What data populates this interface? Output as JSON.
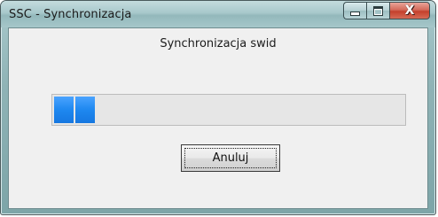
{
  "window": {
    "title": "SSC - Synchronizacja",
    "caption_buttons": {
      "minimize_icon": "minimize-icon",
      "maximize_icon": "maximize-icon",
      "close_glyph": "X"
    }
  },
  "dialog": {
    "message": "Synchronizacja swid",
    "progress": {
      "value_fraction": 0.11,
      "color": "#1e88f0"
    },
    "cancel_label": "Anuluj"
  }
}
